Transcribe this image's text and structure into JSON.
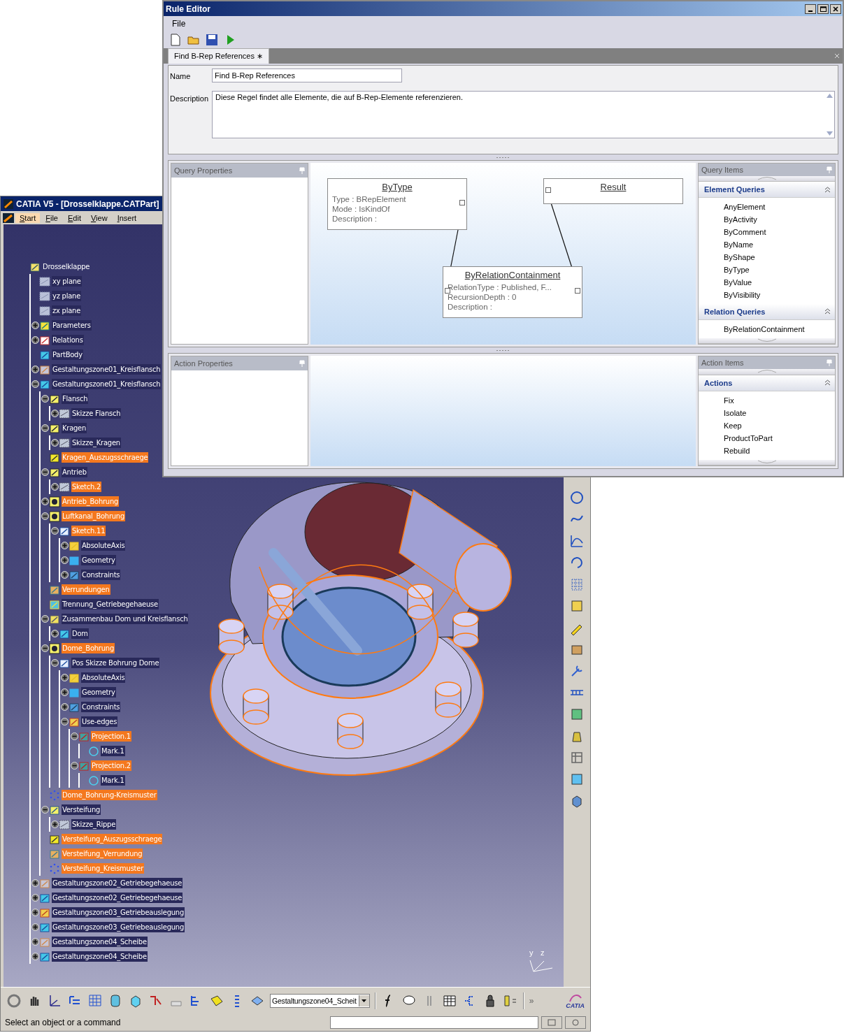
{
  "catia_window": {
    "title": "CATIA V5 - [Drosselklappe.CATPart]",
    "menu": [
      {
        "label": "Start",
        "selected": true
      },
      {
        "label": "File",
        "selected": false
      },
      {
        "label": "Edit",
        "selected": false
      },
      {
        "label": "View",
        "selected": false
      },
      {
        "label": "Insert",
        "selected": false
      }
    ],
    "tree": {
      "label": "Drosselklappe",
      "kind": "part",
      "children": [
        {
          "label": "xy plane",
          "kind": "plane",
          "highlighted": false
        },
        {
          "label": "yz plane",
          "kind": "plane",
          "highlighted": false
        },
        {
          "label": "zx plane",
          "kind": "plane",
          "highlighted": false
        },
        {
          "label": "Parameters",
          "kind": "parameters",
          "highlighted": false,
          "expanded": false
        },
        {
          "label": "Relations",
          "kind": "relations",
          "highlighted": false,
          "expanded": false
        },
        {
          "label": "PartBody",
          "kind": "body",
          "highlighted": false
        },
        {
          "label": "Gestaltungszone01_Kreisflansch",
          "kind": "geoset",
          "highlighted": false,
          "expanded": false
        },
        {
          "label": "Gestaltungszone01_Kreisflansch",
          "kind": "body",
          "highlighted": false,
          "expanded": true,
          "children": [
            {
              "label": "Flansch",
              "kind": "pad",
              "highlighted": false,
              "expanded": true,
              "children": [
                {
                  "label": "Skizze Flansch",
                  "kind": "sketch",
                  "highlighted": false,
                  "expanded": false
                }
              ]
            },
            {
              "label": "Kragen",
              "kind": "pad",
              "highlighted": false,
              "expanded": true,
              "children": [
                {
                  "label": "Skizze_Kragen",
                  "kind": "sketch",
                  "highlighted": false,
                  "expanded": false
                }
              ]
            },
            {
              "label": "Kragen_Auszugsschraege",
              "kind": "draft",
              "highlighted": true
            },
            {
              "label": "Antrieb",
              "kind": "pad",
              "highlighted": false,
              "expanded": true,
              "children": [
                {
                  "label": "Sketch.2",
                  "kind": "sketch",
                  "highlighted": true,
                  "expanded": false
                }
              ]
            },
            {
              "label": "Antrieb_Bohrung",
              "kind": "hole",
              "highlighted": true,
              "expanded": false
            },
            {
              "label": "Luftkanal_Bohrung",
              "kind": "hole",
              "highlighted": true,
              "expanded": true,
              "children": [
                {
                  "label": "Sketch.11",
                  "kind": "sketchopen",
                  "highlighted": true,
                  "expanded": true,
                  "children": [
                    {
                      "label": "AbsoluteAxis",
                      "kind": "axis",
                      "highlighted": false,
                      "expanded": false
                    },
                    {
                      "label": "Geometry",
                      "kind": "geometry",
                      "highlighted": false,
                      "expanded": false
                    },
                    {
                      "label": "Constraints",
                      "kind": "constraints",
                      "highlighted": false,
                      "expanded": false
                    }
                  ]
                }
              ]
            },
            {
              "label": "Verrundungen",
              "kind": "fillet",
              "highlighted": true
            },
            {
              "label": "Trennung_Getriebegehaeuse",
              "kind": "split",
              "highlighted": false
            },
            {
              "label": "Zusammenbau Dom und Kreisflansch",
              "kind": "assemble",
              "highlighted": false,
              "expanded": true,
              "children": [
                {
                  "label": "Dom",
                  "kind": "body",
                  "highlighted": false,
                  "expanded": false
                }
              ]
            },
            {
              "label": "Dome_Bohrung",
              "kind": "hole",
              "highlighted": true,
              "expanded": true,
              "children": [
                {
                  "label": "Pos Skizze Bohrung Dome",
                  "kind": "sketchopen",
                  "highlighted": false,
                  "expanded": true,
                  "children": [
                    {
                      "label": "AbsoluteAxis",
                      "kind": "axis",
                      "highlighted": false,
                      "expanded": false
                    },
                    {
                      "label": "Geometry",
                      "kind": "geometry",
                      "highlighted": false,
                      "expanded": false
                    },
                    {
                      "label": "Constraints",
                      "kind": "constraints",
                      "highlighted": false,
                      "expanded": false
                    },
                    {
                      "label": "Use-edges",
                      "kind": "useedges",
                      "highlighted": false,
                      "expanded": true,
                      "children": [
                        {
                          "label": "Projection.1",
                          "kind": "projection",
                          "highlighted": true,
                          "expanded": true,
                          "children": [
                            {
                              "label": "Mark.1",
                              "kind": "mark",
                              "highlighted": false
                            }
                          ]
                        },
                        {
                          "label": "Projection.2",
                          "kind": "projection",
                          "highlighted": true,
                          "expanded": true,
                          "children": [
                            {
                              "label": "Mark.1",
                              "kind": "mark",
                              "highlighted": false
                            }
                          ]
                        }
                      ]
                    }
                  ]
                }
              ]
            },
            {
              "label": "Dome_Bohrung-Kreismuster",
              "kind": "pattern",
              "highlighted": true
            },
            {
              "label": "Versteifung",
              "kind": "rib",
              "highlighted": false,
              "expanded": true,
              "children": [
                {
                  "label": "Skizze_Rippe",
                  "kind": "sketch",
                  "highlighted": false,
                  "expanded": false
                }
              ]
            },
            {
              "label": "Versteifung_Auszugsschraege",
              "kind": "draft",
              "highlighted": true
            },
            {
              "label": "Versteifung_Verrundung",
              "kind": "fillet",
              "highlighted": true
            },
            {
              "label": "Versteifung_Kreismuster",
              "kind": "pattern",
              "highlighted": true
            }
          ]
        },
        {
          "label": "Gestaltungszone02_Getriebegehaeuse",
          "kind": "geoset",
          "highlighted": false,
          "expanded": false
        },
        {
          "label": "Gestaltungszone02_Getriebegehaeuse",
          "kind": "body",
          "highlighted": false,
          "expanded": false
        },
        {
          "label": "Gestaltungszone03_Getriebeauslegung",
          "kind": "useedges",
          "highlighted": false,
          "expanded": false
        },
        {
          "label": "Gestaltungszone03_Getriebeauslegung",
          "kind": "body",
          "highlighted": false,
          "expanded": false
        },
        {
          "label": "Gestaltungszone04_Scheibe",
          "kind": "geoset",
          "highlighted": false,
          "expanded": false
        },
        {
          "label": "Gestaltungszone04_Scheibe",
          "kind": "body",
          "highlighted": false,
          "expanded": false
        }
      ]
    },
    "axis_labels": [
      "y",
      "z"
    ],
    "toolbar": {
      "dropdown_value": "Gestaltungszone04_Scheit",
      "overflow": "»",
      "logo": "CATIA"
    },
    "status_bar": {
      "message": "Select an object or a command"
    }
  },
  "rule_editor": {
    "title": "Rule Editor",
    "menu": [
      "File"
    ],
    "tabs": [
      {
        "label": "Find B-Rep References ∗",
        "selected": true
      }
    ],
    "name_label": "Name",
    "name_value": "Find B-Rep References",
    "description_label": "Description",
    "description_value": "Diese Regel findet alle Elemente, die auf B-Rep-Elemente referenzieren.",
    "query_properties": {
      "title": "Query Properties"
    },
    "query_canvas": {
      "nodes": [
        {
          "title": "ByType",
          "lines": [
            "Type : BRepElement",
            "Mode : IsKindOf",
            "Description :"
          ]
        },
        {
          "title": "Result"
        },
        {
          "title": "ByRelationContainment",
          "lines": [
            "RelationType : Published, F...",
            "RecursionDepth : 0",
            "Description :"
          ]
        }
      ]
    },
    "query_items": {
      "title": "Query Items",
      "groups": [
        {
          "title": "Element Queries",
          "expanded": true,
          "items": [
            "AnyElement",
            "ByActivity",
            "ByComment",
            "ByName",
            "ByShape",
            "ByType",
            "ByValue",
            "ByVisibility"
          ]
        },
        {
          "title": "Relation Queries",
          "expanded": true,
          "items": [
            "ByRelationContainment"
          ]
        }
      ]
    },
    "action_properties": {
      "title": "Action Properties"
    },
    "action_items": {
      "title": "Action Items",
      "groups": [
        {
          "title": "Actions",
          "expanded": true,
          "items": [
            "Fix",
            "Isolate",
            "Keep",
            "ProductToPart",
            "Rebuild"
          ]
        }
      ]
    }
  }
}
